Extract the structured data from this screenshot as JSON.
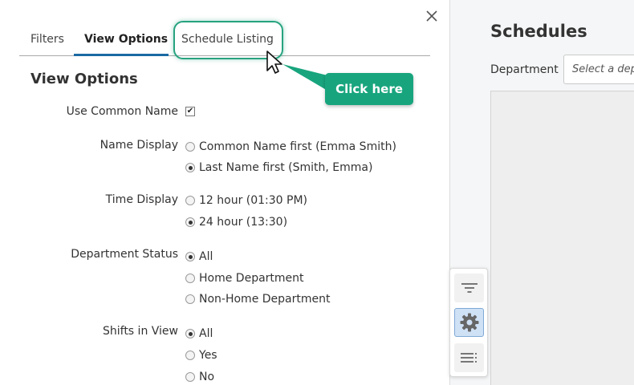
{
  "background": {
    "title": "Schedules",
    "department_label": "Department",
    "department_placeholder": "Select a depa"
  },
  "tabs": [
    {
      "label": "Filters",
      "active": false
    },
    {
      "label": "View Options",
      "active": true
    },
    {
      "label": "Schedule Listing",
      "active": false
    }
  ],
  "section_title": "View Options",
  "settings": {
    "common_name": {
      "label": "Use Common Name",
      "checked": true
    },
    "name_display": {
      "label": "Name Display",
      "options": [
        "Common Name first (Emma Smith)",
        "Last Name first (Smith, Emma)"
      ],
      "selected": 1
    },
    "time_display": {
      "label": "Time Display",
      "options": [
        "12 hour (01:30 PM)",
        "24 hour (13:30)"
      ],
      "selected": 1
    },
    "department_status": {
      "label": "Department Status",
      "options": [
        "All",
        "Home Department",
        "Non-Home Department"
      ],
      "selected": 0
    },
    "shifts_in_view": {
      "label": "Shifts in View",
      "options": [
        "All",
        "Yes",
        "No"
      ],
      "selected": 0
    }
  },
  "annotation": {
    "callout_text": "Click here"
  },
  "icons": {
    "close": "close-icon",
    "filter": "filter-icon",
    "settings": "gear-icon",
    "list": "list-icon"
  },
  "colors": {
    "accent": "#1a6aa3",
    "annotation": "#18a57e"
  }
}
